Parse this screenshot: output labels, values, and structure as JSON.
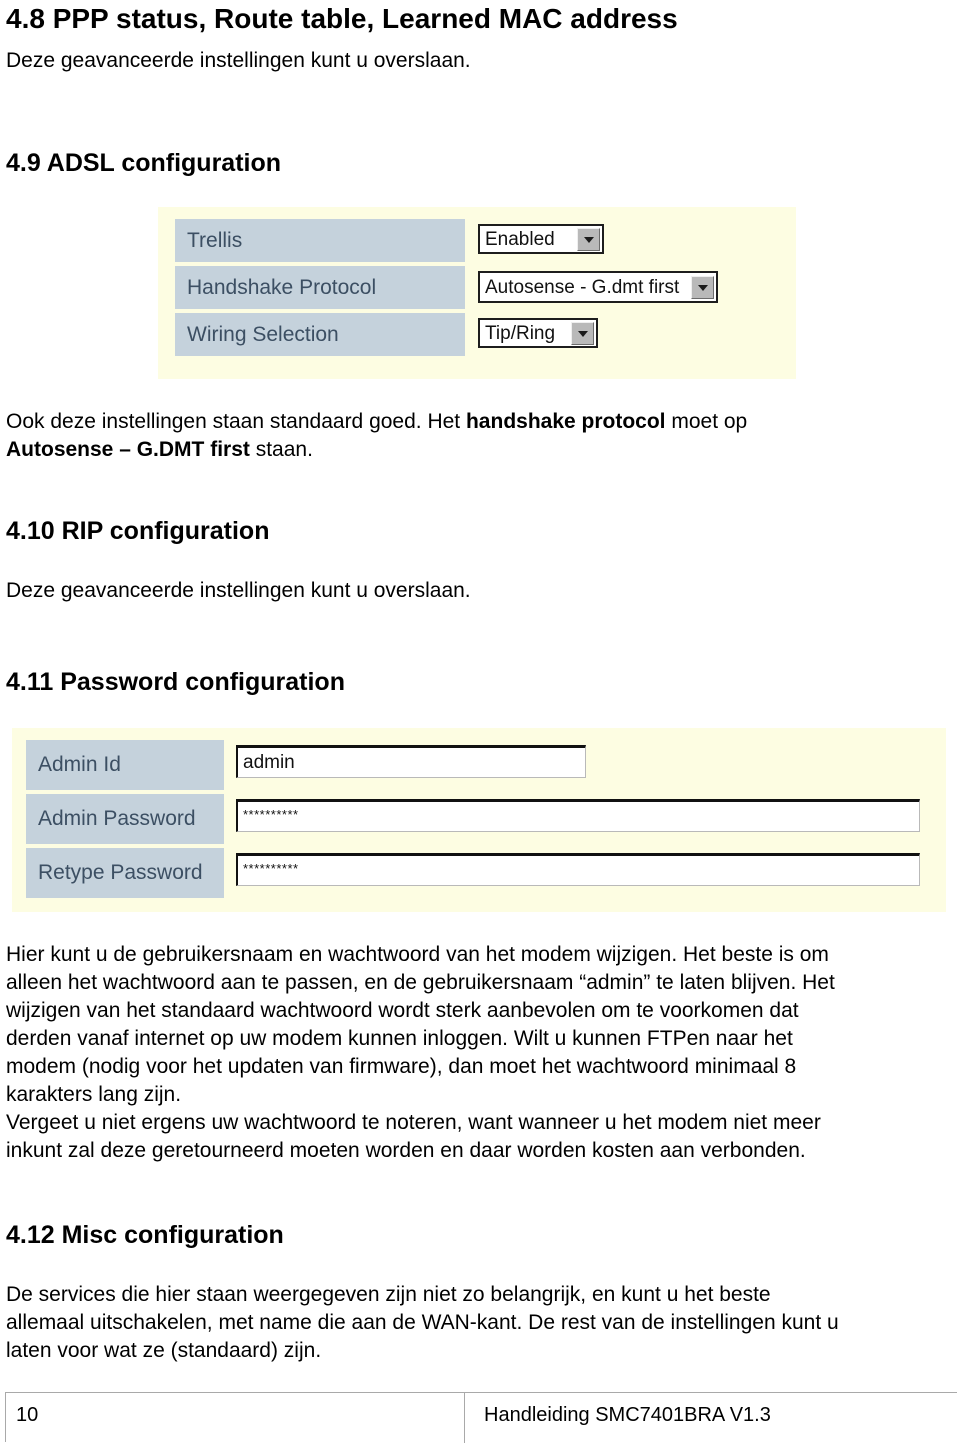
{
  "document": {
    "sections": [
      {
        "id": "s48",
        "heading": "4.8 PPP status, Route table, Learned MAC address",
        "body": "Deze geavanceerde instellingen kunt u overslaan."
      },
      {
        "id": "s49",
        "heading": "4.9 ADSL configuration"
      },
      {
        "id": "s410",
        "heading": "4.10 RIP configuration",
        "body": "Deze geavanceerde instellingen kunt u overslaan."
      },
      {
        "id": "s411",
        "heading": "4.11 Password configuration"
      },
      {
        "id": "s412",
        "heading": "4.12 Misc configuration"
      }
    ]
  },
  "adsl_note": {
    "line1_pre": "Ook deze instellingen staan standaard goed. Het ",
    "line1_bold": "handshake protocol",
    "line1_post": " moet op",
    "line2_bold": "Autosense – G.DMT first",
    "line2_post": " staan."
  },
  "adsl_screenshot": {
    "name": "adsl-configuration-screenshot",
    "background_color": "#fdfde2",
    "label_cell_color": "#c5d2dc",
    "label_text_color": "#3c4f63",
    "rows": [
      {
        "label": "Trellis",
        "value": "Enabled",
        "control": "dropdown"
      },
      {
        "label": "Handshake Protocol",
        "value": "Autosense - G.dmt first",
        "control": "dropdown"
      },
      {
        "label": "Wiring Selection",
        "value": "Tip/Ring",
        "control": "dropdown"
      }
    ]
  },
  "password_screenshot": {
    "name": "password-configuration-screenshot",
    "background_color": "#fdfde2",
    "label_cell_color": "#c5d2dc",
    "label_text_color": "#3c4f63",
    "rows": [
      {
        "label": "Admin Id",
        "value": "admin",
        "control": "text"
      },
      {
        "label": "Admin Password",
        "value": "**********",
        "control": "password"
      },
      {
        "label": "Retype Password",
        "value": "**********",
        "control": "password"
      }
    ]
  },
  "password_note": {
    "line1": "Hier kunt u de gebruikersnaam en wachtwoord van het modem wijzigen. Het beste is om",
    "line2": "alleen het wachtwoord aan te passen, en de gebruikersnaam “admin” te laten blijven. Het",
    "line3": "wijzigen van het standaard wachtwoord wordt sterk aanbevolen om te voorkomen dat",
    "line4": "derden vanaf internet op uw modem kunnen inloggen. Wilt u kunnen FTPen naar het",
    "line5": "modem (nodig voor het updaten van firmware), dan moet het wachtwoord minimaal 8",
    "line6": "karakters lang zijn.",
    "line7": "Vergeet u niet ergens uw wachtwoord te noteren, want wanneer u het modem niet meer",
    "line8": "inkunt zal deze geretourneerd moeten worden en daar worden kosten aan verbonden."
  },
  "misc_note": {
    "line1": "De services die hier staan weergegeven zijn niet zo belangrijk, en kunt u het beste",
    "line2": "allemaal uitschakelen, met name die aan de WAN-kant. De rest van de instellingen kunt u",
    "line3": "laten voor wat ze (standaard) zijn."
  },
  "footer": {
    "page_number": "10",
    "doc_title": "Handleiding SMC7401BRA V1.3"
  }
}
